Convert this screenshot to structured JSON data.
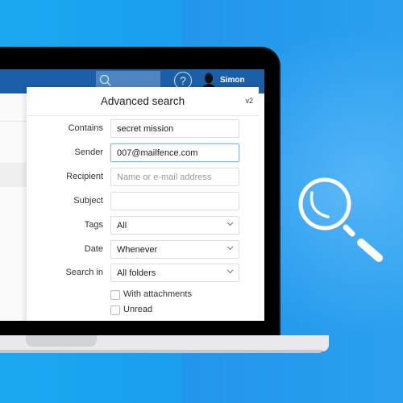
{
  "appbar": {
    "search_icon": "search-icon",
    "help_icon": "question-circle-icon",
    "help_glyph": "?",
    "avatar_icon": "user-silhouette-icon",
    "username": "Simon"
  },
  "advanced_search": {
    "title": "Advanced search",
    "version": "v2",
    "fields": {
      "contains": {
        "label": "Contains",
        "value": "secret mission",
        "placeholder": ""
      },
      "sender": {
        "label": "Sender",
        "value": "007@mailfence.com",
        "placeholder": ""
      },
      "recipient": {
        "label": "Recipient",
        "value": "",
        "placeholder": "Name or e-mail address"
      },
      "subject": {
        "label": "Subject",
        "value": "",
        "placeholder": ""
      },
      "tags": {
        "label": "Tags",
        "selected": "All"
      },
      "date": {
        "label": "Date",
        "selected": "Whenever"
      },
      "search_in": {
        "label": "Search in",
        "selected": "All folders"
      }
    },
    "checkboxes": [
      {
        "label": "With attachments",
        "checked": false
      },
      {
        "label": "Unread",
        "checked": false
      }
    ]
  },
  "decoration": {
    "magnifier_icon": "magnifying-glass-icon"
  },
  "colors": {
    "appbar": "#1a5fa8",
    "background": "#1aa8f0",
    "focus_border": "#8fb7e0"
  }
}
